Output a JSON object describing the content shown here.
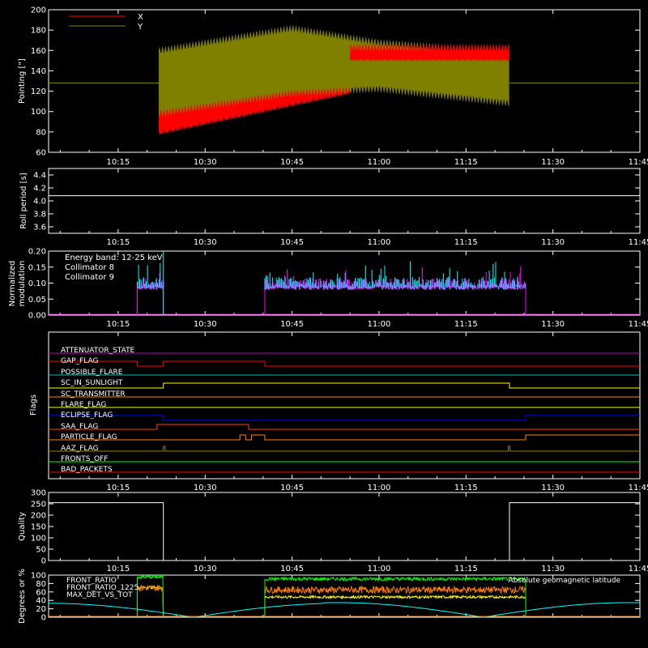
{
  "x_ticks": [
    "10:15",
    "10:30",
    "10:45",
    "11:00",
    "11:15",
    "11:30",
    "11:45"
  ],
  "panels": {
    "pointing": {
      "ylabel": "Pointing [\"]",
      "yticks": [
        "60",
        "80",
        "100",
        "120",
        "140",
        "160",
        "180",
        "200"
      ],
      "legend": [
        {
          "name": "X",
          "color": "#ff0000"
        },
        {
          "name": "Y",
          "color": "#808000"
        }
      ]
    },
    "roll": {
      "ylabel": "Roll period [s]",
      "yticks": [
        "3.6",
        "3.8",
        "4.0",
        "4.2",
        "4.4"
      ]
    },
    "modulation": {
      "ylabel_1": "Normalized",
      "ylabel_2": "modulation",
      "yticks": [
        "0.00",
        "0.05",
        "0.10",
        "0.15",
        "0.20"
      ],
      "energy_text": "Energy band: 12-25 keV",
      "legend": [
        {
          "name": "Collimator 8",
          "color": "#00ffff"
        },
        {
          "name": "Collimator 9",
          "color": "#ff00ff"
        }
      ]
    },
    "flags": {
      "ylabel": "Flags",
      "items": [
        {
          "name": "ATTENUATOR_STATE",
          "color": "#c000c0"
        },
        {
          "name": "GAP_FLAG",
          "color": "#ff0000"
        },
        {
          "name": "POSSIBLE_FLARE",
          "color": "#00c0c0"
        },
        {
          "name": "SC_IN_SUNLIGHT",
          "color": "#ffff00"
        },
        {
          "name": "SC_TRANSMITTER",
          "color": "#ff8000"
        },
        {
          "name": "FLARE_FLAG",
          "color": "#ffff00"
        },
        {
          "name": "ECLIPSE_FLAG",
          "color": "#0000ff"
        },
        {
          "name": "SAA_FLAG",
          "color": "#ff4000"
        },
        {
          "name": "PARTICLE_FLAG",
          "color": "#ff8000"
        },
        {
          "name": "AAZ_FLAG",
          "color": "#a08000"
        },
        {
          "name": "FRONTS_OFF",
          "color": "#00ff00"
        },
        {
          "name": "BAD_PACKETS",
          "color": "#ff0000"
        }
      ]
    },
    "quality": {
      "ylabel": "Quality",
      "yticks": [
        "0",
        "50",
        "100",
        "150",
        "200",
        "250",
        "300"
      ]
    },
    "ratios": {
      "ylabel": "Degrees or %",
      "yticks": [
        "0",
        "20",
        "40",
        "60",
        "80",
        "100"
      ],
      "legend": [
        {
          "name": "FRONT_RATIO",
          "color": "#ffff00"
        },
        {
          "name": "FRONT_RATIO_1225",
          "color": "#00ff00"
        },
        {
          "name": "MAX_DET_VS_TOT",
          "color": "#ff8000"
        }
      ],
      "geo_label": "Absolute geomagnetic latitude",
      "geo_color": "#00ffff"
    }
  },
  "chart_data": [
    {
      "type": "line",
      "x_unit": "UT time",
      "xlim": [
        "10:03",
        "11:45"
      ],
      "ylim": [
        60,
        200
      ],
      "series": [
        {
          "name": "X",
          "segments": [
            {
              "t_start": "10:22",
              "t_end": "11:22",
              "values_range": [
                [
                  78,
                  160
                ],
                [
                  110,
                  140
                ],
                [
                  120,
                  160
                ],
                [
                  128,
                  165
                ]
              ]
            }
          ],
          "baseline": 128
        },
        {
          "name": "Y",
          "segments": [
            {
              "t_start": "10:22",
              "t_end": "11:22",
              "envelope": [
                [
                  "10:22",
                  95,
                  160
                ],
                [
                  "10:45",
                  118,
                  182
                ],
                [
                  "11:00",
                  122,
                  168
                ],
                [
                  "11:22",
                  108,
                  158
                ]
              ]
            }
          ]
        }
      ]
    },
    {
      "type": "line",
      "ylim": [
        3.5,
        4.5
      ],
      "series": [
        {
          "values": [
            4.08
          ]
        }
      ]
    },
    {
      "type": "bar",
      "ylim": [
        0,
        0.2
      ],
      "series": [
        {
          "name": "Collimator 8",
          "segments": [
            [
              "10:18",
              "10:23"
            ],
            [
              "10:40",
              "11:26"
            ]
          ],
          "mean": 0.1
        },
        {
          "name": "Collimator 9",
          "segments": [
            [
              "10:18",
              "10:23"
            ],
            [
              "10:40",
              "11:26"
            ]
          ],
          "mean": 0.09
        }
      ]
    },
    {
      "type": "line",
      "ylim": [
        0,
        300
      ],
      "series": [
        {
          "values": [
            [
              "10:03",
              255
            ],
            [
              "10:23",
              255
            ],
            [
              "10:23",
              0
            ],
            [
              "11:22",
              0
            ],
            [
              "11:22",
              255
            ],
            [
              "11:45",
              255
            ]
          ]
        }
      ]
    },
    {
      "type": "line",
      "ylim": [
        0,
        100
      ],
      "series": [
        {
          "name": "FRONT_RATIO",
          "mean": 48
        },
        {
          "name": "FRONT_RATIO_1225",
          "mean": 92
        },
        {
          "name": "MAX_DET_VS_TOT",
          "mean": 65
        },
        {
          "name": "Absolute geomagnetic latitude",
          "peaks": [
            [
              "10:03",
              33
            ],
            [
              "10:30",
              0
            ],
            [
              "10:57",
              35
            ],
            [
              "11:20",
              0
            ],
            [
              "11:45",
              35
            ]
          ]
        }
      ]
    }
  ]
}
